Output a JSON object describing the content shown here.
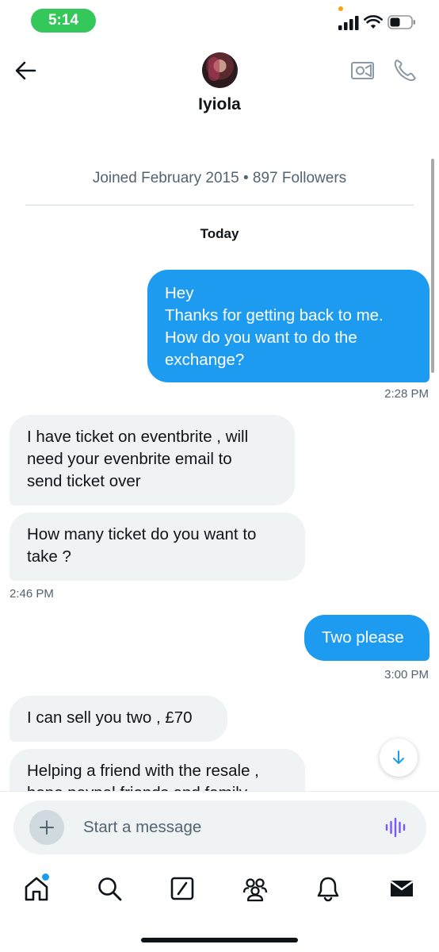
{
  "status_bar": {
    "time": "5:14",
    "icons": [
      "signal-icon",
      "wifi-icon",
      "battery-icon"
    ]
  },
  "header": {
    "contact_name": "Iyiola",
    "actions": [
      "back-arrow-icon",
      "video-call-icon",
      "phone-call-icon"
    ]
  },
  "profile_meta": {
    "joined": "Joined February 2015 • 897 Followers"
  },
  "conversation": {
    "date_label": "Today",
    "messages": [
      {
        "direction": "outgoing",
        "lines": [
          "Hey",
          "Thanks for getting back to me.",
          "How do you want to do the",
          "exchange?"
        ]
      },
      {
        "direction": "incoming",
        "lines": [
          "I have ticket on eventbrite , will",
          "need your evenbrite email to",
          "send ticket over"
        ]
      },
      {
        "direction": "incoming",
        "lines": [
          "How many ticket do you want to",
          "take ?"
        ]
      },
      {
        "direction": "outgoing",
        "lines": [
          "Two please"
        ]
      },
      {
        "direction": "incoming",
        "lines": [
          "I can sell you two , £70"
        ]
      },
      {
        "direction": "incoming",
        "lines": [
          "Helping a friend with the resale ,",
          "hope paypal friends and family"
        ]
      }
    ],
    "timestamps": [
      "2:28 PM",
      "2:46 PM",
      "3:00 PM"
    ]
  },
  "composer": {
    "placeholder": "Start a message"
  },
  "tab_bar": {
    "tabs": [
      "home-icon",
      "search-icon",
      "grok-icon",
      "communities-icon",
      "notifications-icon",
      "messages-icon"
    ],
    "home_has_badge": true
  },
  "colors": {
    "accent": "#1d9bf0",
    "incoming_bubble": "#eff3f4",
    "status_time_pill": "#34c759",
    "voice_icon": "#7856ff"
  }
}
